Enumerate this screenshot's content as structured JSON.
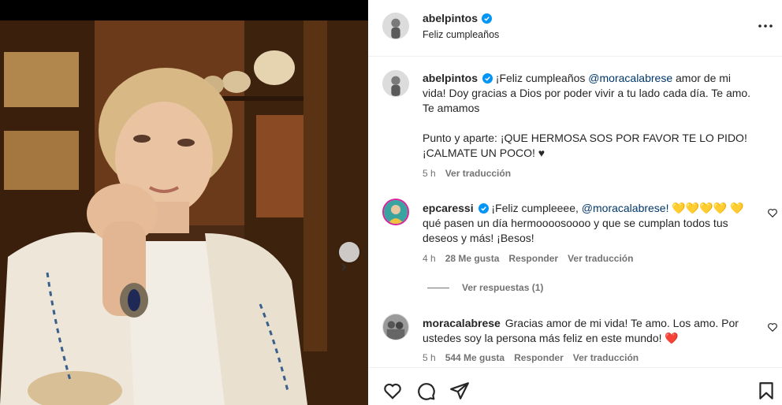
{
  "post": {
    "author": "abelpintos",
    "caption_header": "Feliz cumpleaños",
    "photo_alt": "photo",
    "caption": {
      "line1_prefix": "¡Feliz cumpleaños ",
      "mention": "@moracalabrese",
      "line1_suffix": " amor de mi vida! Doy gracias a Dios por poder vivir a tu lado cada día. Te amo. Te amamos",
      "line2": "Punto y aparte: ¡QUE HERMOSA SOS POR FAVOR TE LO PIDO! ¡CALMATE UN POCO! ♥",
      "time": "5 h",
      "translate": "Ver traducción"
    }
  },
  "comments": [
    {
      "user": "epcaressi",
      "prefix": "¡Feliz cumpleeee, ",
      "mention": "@moracalabrese!",
      "hearts": "💛💛💛💛",
      "heart2": "💛",
      "text": " qué pasen un día hermoooosoooo y que se cumplan todos tus deseos y más! ¡Besos!",
      "time": "4 h",
      "likes": "28 Me gusta",
      "reply": "Responder",
      "translate": "Ver traducción",
      "view_replies": "Ver respuestas (1)"
    },
    {
      "user": "moracalabrese",
      "text": "Gracias amor de mi vida! Te amo. Los amo. Por ustedes soy la persona más feliz en este mundo! ❤️",
      "time": "5 h",
      "likes": "544 Me gusta",
      "reply": "Responder",
      "translate": "Ver traducción"
    }
  ],
  "icons": {
    "verified": "verified-badge-icon",
    "more": "more-options-icon",
    "like": "heart-icon",
    "comment": "comment-icon",
    "share": "share-icon",
    "save": "bookmark-icon",
    "next": "chevron-right-icon"
  },
  "colors": {
    "verified_blue": "#0095f6",
    "text": "#262626",
    "secondary": "#737373",
    "mention": "#00376b"
  }
}
